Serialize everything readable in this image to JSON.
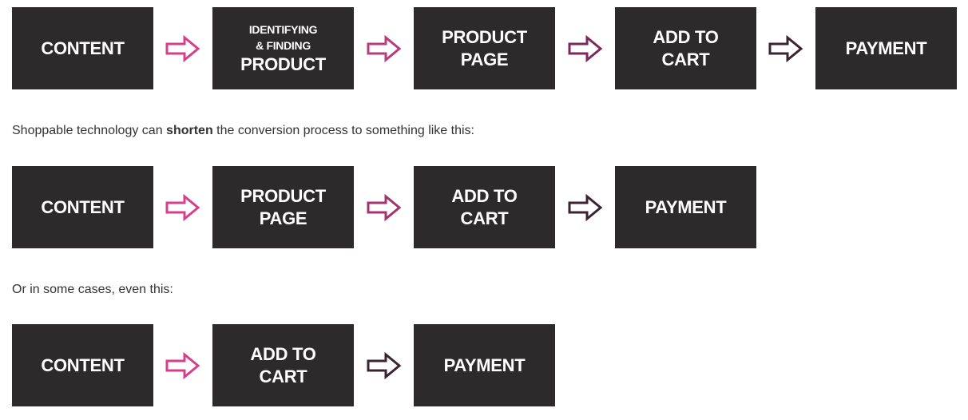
{
  "rows": [
    {
      "steps": [
        [
          "CONTENT"
        ],
        [
          "IDENTIFYING",
          "& FINDING",
          "PRODUCT"
        ],
        [
          "PRODUCT",
          "PAGE"
        ],
        [
          "ADD TO",
          "CART"
        ],
        [
          "PAYMENT"
        ]
      ],
      "arrow_colors": [
        "#d6408a",
        "#b83c7c",
        "#7b2a5b",
        "#3a2430"
      ]
    },
    {
      "steps": [
        [
          "CONTENT"
        ],
        [
          "PRODUCT",
          "PAGE"
        ],
        [
          "ADD TO",
          "CART"
        ],
        [
          "PAYMENT"
        ]
      ],
      "arrow_colors": [
        "#d6408a",
        "#a3346e",
        "#3a2430"
      ]
    },
    {
      "steps": [
        [
          "CONTENT"
        ],
        [
          "ADD TO",
          "CART"
        ],
        [
          "PAYMENT"
        ]
      ],
      "arrow_colors": [
        "#d6408a",
        "#3a2430"
      ]
    }
  ],
  "text1": {
    "before": "Shoppable technology can ",
    "bold": "shorten",
    "after": " the conversion process to something like this:"
  },
  "text2": "Or in some cases, even this:"
}
